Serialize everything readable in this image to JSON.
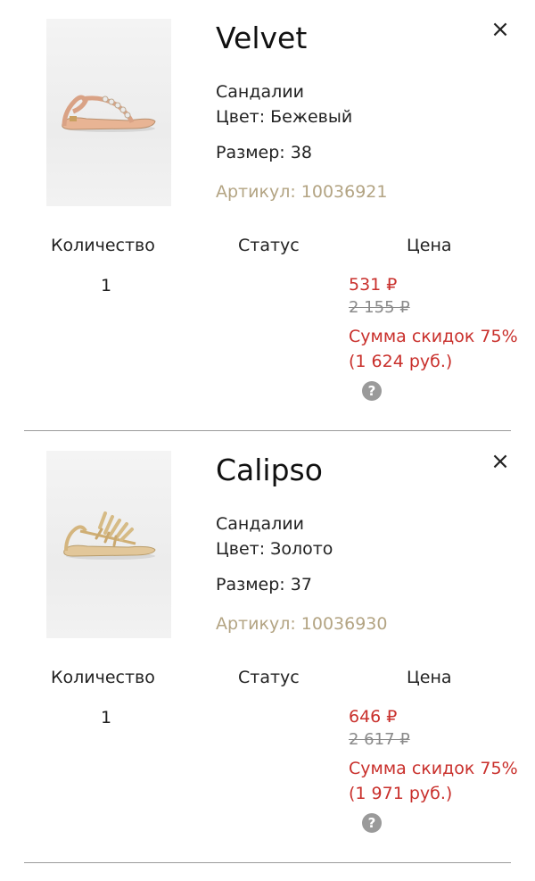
{
  "labels": {
    "quantity_header": "Количество",
    "status_header": "Статус",
    "price_header": "Цена",
    "remove": "×",
    "help": "?"
  },
  "items": [
    {
      "name": "Velvet",
      "category": "Сандалии",
      "color": "Цвет: Бежевый",
      "size": "Размер: 38",
      "sku": "Артикул: 10036921",
      "quantity": "1",
      "status": "",
      "price": "531 ₽",
      "old_price": "2 155 ₽",
      "discount": "Сумма скидок 75% (1 624 руб.)",
      "image_icon": "beige-sandal"
    },
    {
      "name": "Calipso",
      "category": "Сандалии",
      "color": "Цвет: Золото",
      "size": "Размер: 37",
      "sku": "Артикул: 10036930",
      "quantity": "1",
      "status": "",
      "price": "646 ₽",
      "old_price": "2 617 ₽",
      "discount": "Сумма скидок 75% (1 971 руб.)",
      "image_icon": "gold-sandal"
    }
  ],
  "colors": {
    "price_red": "#c9302c",
    "sku_gold": "#b3a483",
    "old_price_gray": "#8a8a8a",
    "divider": "#9b9b9b"
  }
}
